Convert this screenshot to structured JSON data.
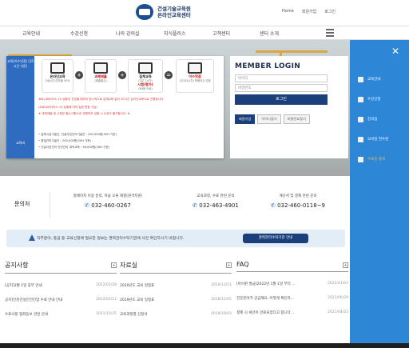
{
  "header": {
    "logo_line1": "건설기술교육원",
    "logo_line2": "온라인교육센터",
    "links": [
      "Home",
      "회원가입",
      "로그인"
    ]
  },
  "nav": {
    "items": [
      "교육안내",
      "수강신청",
      "나의 강의실",
      "지식플러스",
      "고객센터",
      "센터 소개"
    ]
  },
  "card": {
    "side1": "교육(이수인정)\n(35시간 기준)",
    "side2": "교육비",
    "steps": [
      {
        "title": "온라인교육",
        "sub": "(28시간)진도율 50%"
      },
      {
        "title": "과제제출",
        "sub": "(제출필수)"
      },
      {
        "title": "집체교육",
        "sub": "(1일 7시간)"
      },
      {
        "title": "이수학점",
        "sub": "1주(35시간)\n학점이수 인정"
      }
    ],
    "exam_label": "시험(평가)",
    "exam_sub": "(60점 이상)",
    "note1": "코로나바이러스-19 상황이 진정될 때까지 한시적으로 집체교육 없이 35시간 온라인교육으로 진행됩니다.",
    "note2": "(코로나바이러스-19 상황에 따라 일정 변동 가능)",
    "note3": "★ 과제제출 및 시험은 필수사항으로 진행하지 않을 시 수료가 불가합니다. ★",
    "fees": [
      "집체시공기술인, 건설사업관리기술인 : 200,000원(35H 기준)",
      "품질관리기술인 : 200,000원(35H 기준)",
      "건설사업관리 안전관리 계속교육 : 96,000원(16H 기준)"
    ]
  },
  "login": {
    "title": "MEMBER LOGIN",
    "id_placeholder": "아이디",
    "pw_placeholder": "비밀번호",
    "submit": "로그인",
    "links": [
      "회원가입",
      "아이디찾기",
      "비밀번호찾기"
    ]
  },
  "panel": {
    "items": [
      "교육안내",
      "수강신청",
      "강의실",
      "모바일 연수원",
      "수료증 출력"
    ],
    "highlight_index": 4,
    "bg": "#2d86d6"
  },
  "contact": {
    "label": "문의처",
    "items": [
      {
        "desc": "홈페이지 이용 문의, 학습 오류 해결(원격지원)",
        "phone": "032-460-0267"
      },
      {
        "desc": "교육과정, 수료 관련 문의",
        "phone": "032-463-4901"
      },
      {
        "desc": "계산서 및 결제 관련 문의",
        "phone": "032-460-0118~9"
      }
    ]
  },
  "notice_bar": {
    "text": "직무분야, 등급 등 교육신청에 필요한 정보는 경력관리수탁기관에 사전 확인하시기 바랍니다.",
    "button": "경력관리수탁기관 안내"
  },
  "columns": [
    {
      "title": "공지사항",
      "rows": [
        [
          "[공지]3월 1일 휴무 안내",
          "2022/02/28"
        ],
        [
          "공지]인천건설인전인업 수료 안내 안내",
          "2022/02/11"
        ],
        [
          "수료사항 협회동보 관련 안내",
          "2021/10/25"
        ]
      ]
    },
    {
      "title": "자료실",
      "rows": [
        [
          "2020년도 교육 일정표",
          "2019/12/11"
        ],
        [
          "2019년도 교육 일정표",
          "2018/12/05"
        ],
        [
          "교육과정별 신청서",
          "2018/10/03"
        ]
      ]
    },
    {
      "title": "FAQ",
      "rows": [
        [
          "[아이핀 발급]2022년 1월 1일 부터 ...",
          "2022/01/03"
        ],
        [
          "전문분야가 궁금해요, 어떻게 확인하...",
          "2021/06/29"
        ],
        [
          "결제 시 세션이 만료되었다고 합니다...",
          "2021/04/23"
        ]
      ]
    }
  ],
  "colors": {
    "primary": "#1b3f7a",
    "panel": "#2d86d6",
    "accent": "#f2b84b"
  }
}
